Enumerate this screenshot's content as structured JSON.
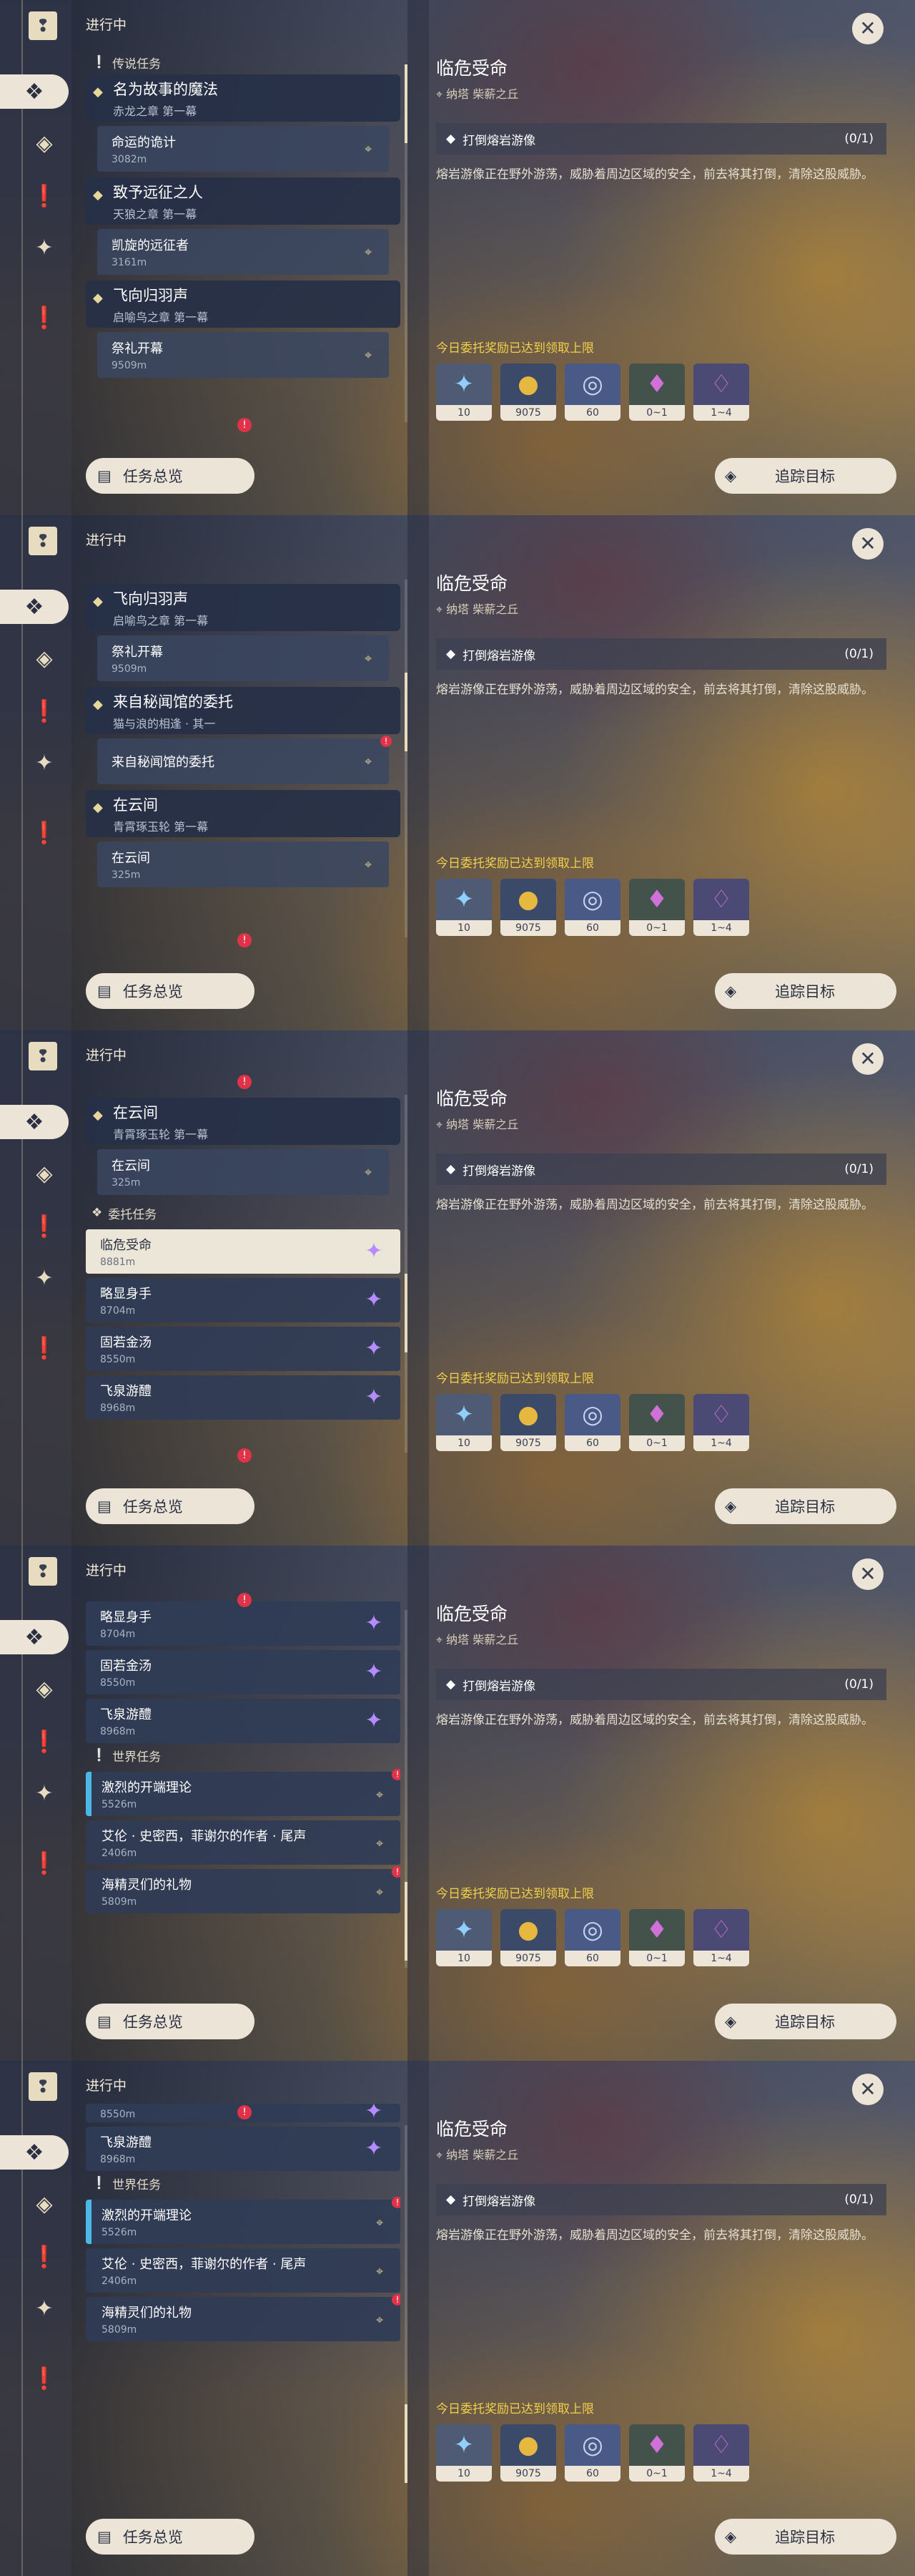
{
  "common": {
    "tab_title": "进行中",
    "overview_label": "任务总览",
    "track_label": "追踪目标",
    "detail_title": "临危受命",
    "detail_location": "纳塔 柴薪之丘",
    "objective": "打倒熔岩游像",
    "progress": "(0/1)",
    "desc": "熔岩游像正在野外游荡，威胁着周边区域的安全，前去将其打倒，清除这股威胁。",
    "reward_note": "今日委托奖励已达到领取上限",
    "rewards": [
      {
        "icon": "star-icon",
        "count": "10"
      },
      {
        "icon": "coin-icon",
        "count": "9075"
      },
      {
        "icon": "wisdom-icon",
        "count": "60"
      },
      {
        "icon": "crystal-icon",
        "count": "0~1"
      },
      {
        "icon": "crystal-cluster-icon",
        "count": "1~4"
      }
    ],
    "sections": {
      "legend": "传说任务",
      "commission": "委托任务",
      "world": "世界任务"
    },
    "quests": {
      "q1": {
        "title": "名为故事的魔法",
        "sub": "赤龙之章 第一幕",
        "step": "命运的诡计",
        "dist": "3082m"
      },
      "q2": {
        "title": "致予远征之人",
        "sub": "天狼之章 第一幕",
        "step": "凯旋的远征者",
        "dist": "3161m"
      },
      "q3": {
        "title": "飞向归羽声",
        "sub": "启喻鸟之章 第一幕",
        "step": "祭礼开幕",
        "dist": "9509m"
      },
      "q4": {
        "title": "来自秘闻馆的委托",
        "sub": "猫与浪的相逢 · 其一",
        "step": "来自秘闻馆的委托",
        "dist": ""
      },
      "q5": {
        "title": "在云间",
        "sub": "青霄琢玉轮 第一幕",
        "step": "在云间",
        "dist": "325m"
      }
    },
    "commissions": [
      {
        "title": "临危受命",
        "dist": "8881m"
      },
      {
        "title": "略显身手",
        "dist": "8704m"
      },
      {
        "title": "固若金汤",
        "dist": "8550m"
      },
      {
        "title": "飞泉游醴",
        "dist": "8968m"
      }
    ],
    "worlds": [
      {
        "title": "激烈的开端理论",
        "dist": "5526m"
      },
      {
        "title": "艾伦 · 史密西，菲谢尔的作者 · 尾声",
        "dist": "2406m"
      },
      {
        "title": "海精灵们的礼物",
        "dist": "5809m"
      }
    ]
  }
}
